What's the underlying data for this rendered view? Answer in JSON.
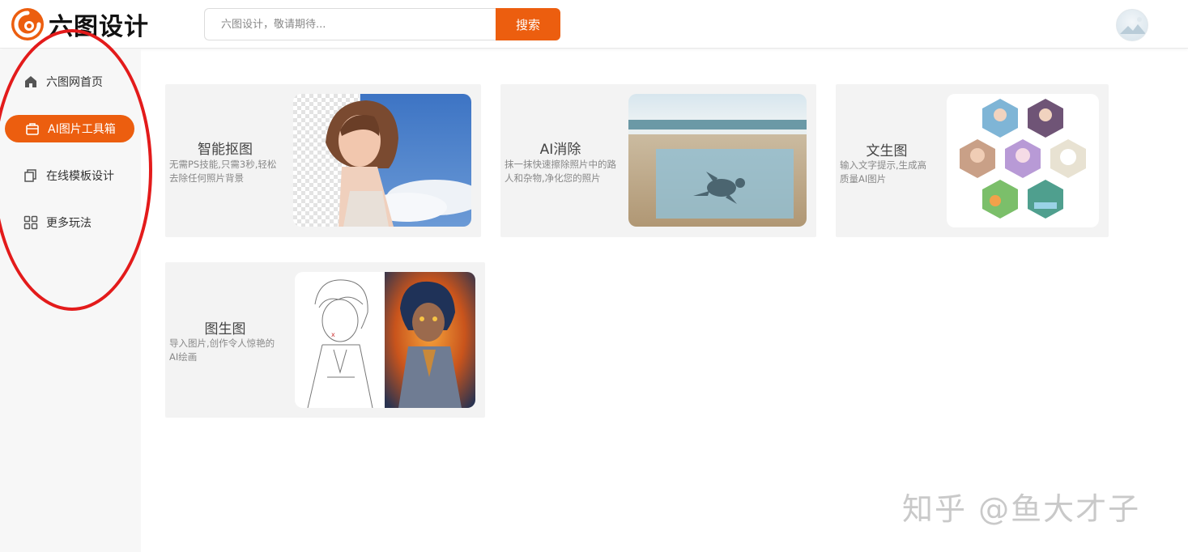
{
  "header": {
    "logo_text": "六图设计",
    "search_placeholder": "六图设计，敬请期待...",
    "search_button": "搜索"
  },
  "sidebar": {
    "items": [
      {
        "label": "六图网首页",
        "icon": "home-icon"
      },
      {
        "label": "AI图片工具箱",
        "icon": "toolbox-icon",
        "active": true
      },
      {
        "label": "在线模板设计",
        "icon": "template-icon"
      },
      {
        "label": "更多玩法",
        "icon": "grid-icon"
      }
    ]
  },
  "cards": [
    {
      "title": "智能抠图",
      "desc": "无需PS技能,只需3秒,轻松去除任何照片背景"
    },
    {
      "title": "AI消除",
      "desc": "抹一抹快速擦除照片中的路人和杂物,净化您的照片"
    },
    {
      "title": "文生图",
      "desc": "输入文字提示,生成高质量AI图片"
    },
    {
      "title": "图生图",
      "desc": "导入图片,创作令人惊艳的AI绘画"
    }
  ],
  "watermark": "知乎 @鱼大才子",
  "colors": {
    "accent": "#ec5e0f",
    "annotation": "#e31b1b"
  }
}
